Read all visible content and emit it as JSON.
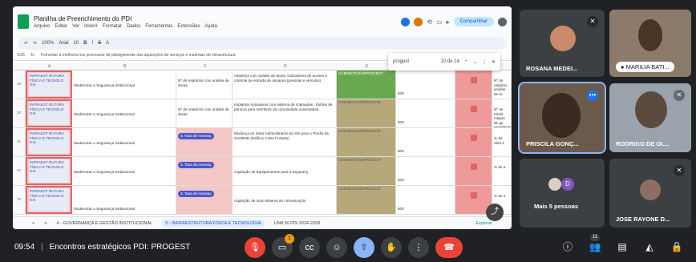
{
  "sheet": {
    "title": "Planilha de Preenchimento do PDI",
    "menu": [
      "Arquivo",
      "Editar",
      "Ver",
      "Inserir",
      "Formatar",
      "Dados",
      "Ferramentas",
      "Extensões",
      "Ajuda"
    ],
    "share_label": "Compartilhar",
    "toolbar": {
      "zoom": "100%",
      "font": "Arial",
      "font_size": "10"
    },
    "cell_ref": "E25",
    "formula": "Fomentar a melhoria nos processos de planejamento das aquisições de serviços e materiais de infraestrutura",
    "find": {
      "query": "progest",
      "count": "10 de 14"
    },
    "columns": [
      "A",
      "B",
      "C",
      "D",
      "E",
      "F",
      "G"
    ],
    "rows": [
      {
        "num": "29",
        "a": "INFRAEST RUTURA FÍSICA E TECNOLO GIA",
        "b": "Modernizar a Segurança Institucional",
        "c": "Nº de relatórios com análise de áreas.",
        "d": "relatórios com análise de áreas, indicadores de acesso e controle de entrada de usuários (pessoas e veículos)",
        "e": "GABINETE/SSI/PROGEST",
        "f": "500",
        "h": "Nº de relatório análise de ár"
      },
      {
        "num": "30",
        "a": "INFRAEST RUTURA FÍSICA E TECNOLO GIA",
        "b": "Modernizar a Segurança Institucional",
        "c": "Nº de relatórios com análise de áreas.",
        "d": "Implantar Aplicativos com sistema de chamadas - botões de pânicos para membros da comunidade universitária",
        "e": "GABINETE/SSI/PROGEST",
        "f": "500",
        "h": "Nº de relató mapas de ge georeferencia"
      },
      {
        "num": "31",
        "a": "INFRAEST RUTURA FÍSICA E TECNOLO GIA",
        "b": "Modernizar a Segurança Institucional",
        "c": "3. Taxa de renovaç",
        "d": "Mudança do Setor Administrativo da SSI para o Prédio da SUDENE (Edifício Celso Furtado)",
        "e": "GABINETE/SSI/PROGEST",
        "f": "500",
        "h": "% de obra e"
      },
      {
        "num": "32",
        "a": "INFRAEST RUTURA FÍSICA E TECNOLO GIA",
        "b": "Modernizar a Segurança Institucional",
        "c": "3. Taxa de renovaç",
        "d": "Aquisição de Equipamentos para a Seguranç",
        "e": "GABINETE/SSI/PROGEST",
        "f": "500",
        "h": "% de a"
      },
      {
        "num": "33",
        "a": "INFRAEST RUTURA FÍSICA E TECNOLO GIA",
        "b": "Modernizar a Segurança Institucional",
        "c": "3. Taxa de renovaç",
        "d": "Aquisição de novo sistema de comunicação",
        "e": "GABINETE/SSI/PROGEST",
        "f": "500",
        "h": "% de a"
      }
    ],
    "tabs": [
      "4 - GOVERNANÇA E GESTÃO INSTITUCIONAL",
      "5 - INFRAESTRUTURA FÍSICA E TECNOLOGIA",
      "LINK BI PDI 2024-2028"
    ],
    "explore": "Explorar"
  },
  "participants": [
    {
      "name": "ROSANA MEDEI...",
      "muted": true
    },
    {
      "name": "MARILIA BATI...",
      "muted": false
    },
    {
      "name": "PRISCILA GONÇ...",
      "muted": false,
      "speaking": true
    },
    {
      "name": "RODRIGO DE OL...",
      "muted": true
    },
    {
      "name": "Mais 5 pessoas",
      "initial": "D"
    },
    {
      "name": "JOSE RAYONE D...",
      "muted": true
    }
  ],
  "bar": {
    "time": "09:54",
    "meeting": "Encontros estratégicos PDI: PROGEST",
    "people_count": "11",
    "reactions_badge": "1"
  },
  "colors": {
    "accent": "#8ab4f8",
    "danger": "#ea4335",
    "speaking": "#8ab4f8"
  }
}
